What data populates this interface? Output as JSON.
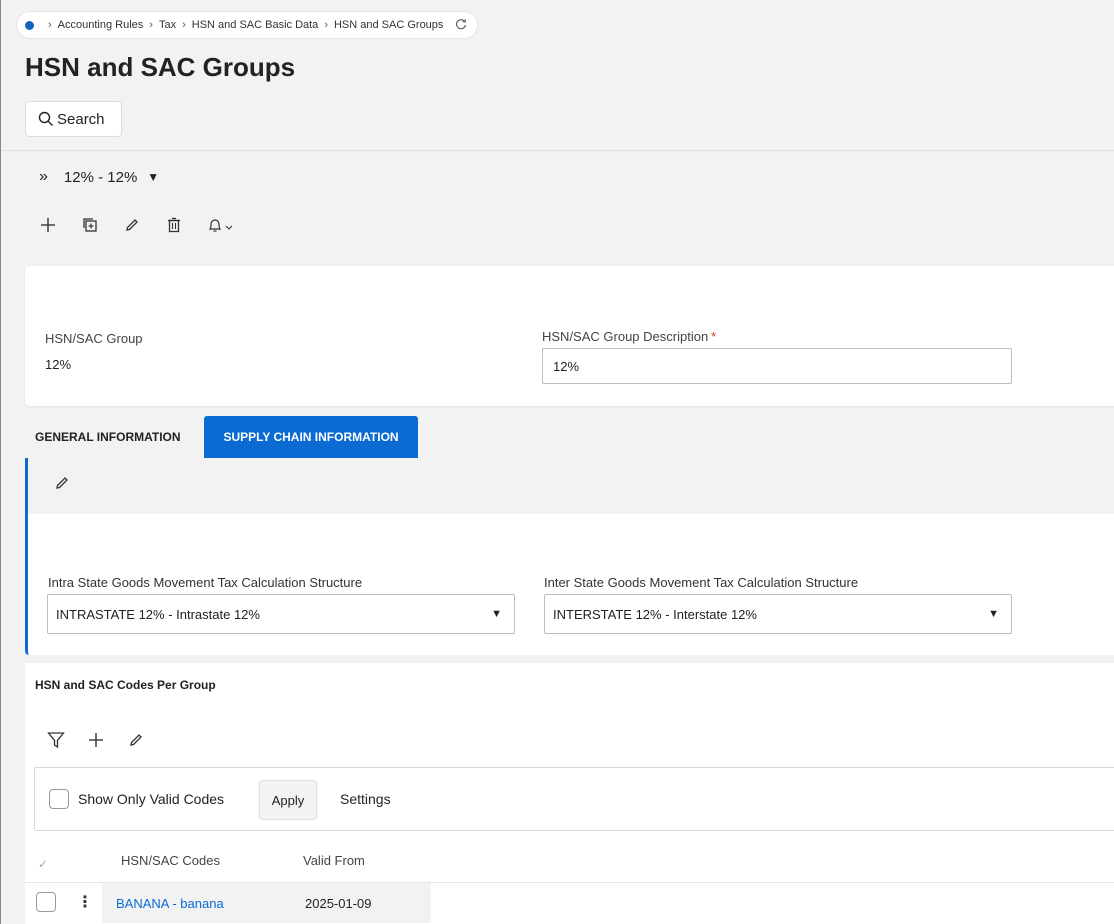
{
  "breadcrumb": {
    "items": [
      "Accounting Rules",
      "Tax",
      "HSN and SAC Basic Data",
      "HSN and SAC Groups"
    ]
  },
  "page": {
    "title": "HSN and SAC Groups",
    "search_label": "Search"
  },
  "record_selector": {
    "value": "12% - 12%"
  },
  "header": {
    "group_label": "HSN/SAC Group",
    "group_value": "12%",
    "description_label": "HSN/SAC Group Description",
    "required_mark": "*",
    "description_value": "12%"
  },
  "tabs": [
    {
      "label": "GENERAL INFORMATION",
      "active": false
    },
    {
      "label": "SUPPLY CHAIN INFORMATION",
      "active": true
    }
  ],
  "supply_chain": {
    "intra_label": "Intra State Goods Movement Tax Calculation Structure",
    "intra_value": "INTRASTATE 12% - Intrastate 12%",
    "inter_label": "Inter State Goods Movement Tax Calculation Structure",
    "inter_value": "INTERSTATE 12% - Interstate 12%"
  },
  "codes_section": {
    "title": "HSN and SAC Codes Per Group",
    "show_valid_label": "Show Only Valid Codes",
    "apply_label": "Apply",
    "settings_label": "Settings",
    "columns": [
      "HSN/SAC Codes",
      "Valid From"
    ],
    "rows": [
      {
        "code": "BANANA - banana",
        "valid_from": "2025-01-09"
      }
    ]
  },
  "colors": {
    "accent": "#0b6bd3",
    "required": "#d9382b"
  }
}
